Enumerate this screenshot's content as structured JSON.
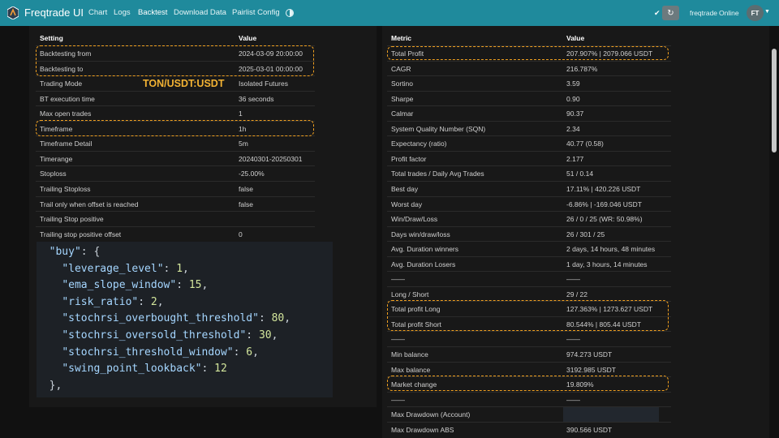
{
  "navbar": {
    "brand": "Freqtrade UI",
    "links": [
      "Chart",
      "Logs",
      "Backtest",
      "Download Data",
      "Pairlist Config"
    ],
    "active_link": "Backtest",
    "bot_name": "freqtrade",
    "bot_status": "Online",
    "avatar_initials": "FT",
    "icons": [
      "freqtrade-logo",
      "theme-toggle-icon",
      "check-icon",
      "refresh-icon",
      "caret-down-icon"
    ]
  },
  "left_table": {
    "header_setting": "Setting",
    "header_value": "Value",
    "rows": [
      {
        "label": "Backtesting from",
        "value": "2024-03-09 20:00:00"
      },
      {
        "label": "Backtesting to",
        "value": "2025-03-01 00:00:00"
      },
      {
        "label": "Trading Mode",
        "value": "Isolated Futures"
      },
      {
        "label": "BT execution time",
        "value": "36 seconds"
      },
      {
        "label": "Max open trades",
        "value": "1"
      },
      {
        "label": "Timeframe",
        "value": "1h"
      },
      {
        "label": "Timeframe Detail",
        "value": "5m"
      },
      {
        "label": "Timerange",
        "value": "20240301-20250301"
      },
      {
        "label": "Stoploss",
        "value": "-25.00%"
      },
      {
        "label": "Trailing Stoploss",
        "value": "false"
      },
      {
        "label": "Trail only when offset is reached",
        "value": "false"
      },
      {
        "label": "Trailing Stop positive",
        "value": ""
      },
      {
        "label": "Trailing stop positive offset",
        "value": "0"
      }
    ]
  },
  "overlay_label": "TON/USDT:USDT",
  "code": {
    "open_key": "buy",
    "params": [
      {
        "key": "leverage_level",
        "value": "1"
      },
      {
        "key": "ema_slope_window",
        "value": "15"
      },
      {
        "key": "risk_ratio",
        "value": "2"
      },
      {
        "key": "stochrsi_overbought_threshold",
        "value": "80"
      },
      {
        "key": "stochrsi_oversold_threshold",
        "value": "30"
      },
      {
        "key": "stochrsi_threshold_window",
        "value": "6"
      },
      {
        "key": "swing_point_lookback",
        "value": "12"
      }
    ],
    "close": "},"
  },
  "right_table": {
    "header_metric": "Metric",
    "header_value": "Value",
    "rows": [
      {
        "label": "Total Profit",
        "value": "207.907% | 2079.066 USDT"
      },
      {
        "label": "CAGR",
        "value": "216.787%"
      },
      {
        "label": "Sortino",
        "value": "3.59"
      },
      {
        "label": "Sharpe",
        "value": "0.90"
      },
      {
        "label": "Calmar",
        "value": "90.37"
      },
      {
        "label": "System Quality Number (SQN)",
        "value": "2.34"
      },
      {
        "label": "Expectancy (ratio)",
        "value": "40.77 (0.58)"
      },
      {
        "label": "Profit factor",
        "value": "2.177"
      },
      {
        "label": "Total trades / Daily Avg Trades",
        "value": "51 / 0.14"
      },
      {
        "label": "Best day",
        "value": "17.11% | 420.226 USDT"
      },
      {
        "label": "Worst day",
        "value": "-6.86% | -169.046 USDT"
      },
      {
        "label": "Win/Draw/Loss",
        "value": "26 / 0 / 25 (WR: 50.98%)"
      },
      {
        "label": "Days win/draw/loss",
        "value": "26 / 301 / 25"
      },
      {
        "label": "Avg. Duration winners",
        "value": "2 days, 14 hours, 48 minutes"
      },
      {
        "label": "Avg. Duration Losers",
        "value": "1 day, 3 hours, 14 minutes"
      },
      {
        "label": "——",
        "value": "——"
      },
      {
        "label": "Long / Short",
        "value": "29 / 22"
      },
      {
        "label": "Total profit Long",
        "value": "127.363% | 1273.627 USDT"
      },
      {
        "label": "Total profit Short",
        "value": "80.544% | 805.44 USDT"
      },
      {
        "label": "——",
        "value": "——"
      },
      {
        "label": "Min balance",
        "value": "974.273 USDT"
      },
      {
        "label": "Max balance",
        "value": "3192.985 USDT"
      },
      {
        "label": "Market change",
        "value": "19.809%"
      },
      {
        "label": "——",
        "value": "——"
      },
      {
        "label": "Max Drawdown (Account)",
        "value": ""
      },
      {
        "label": "Max Drawdown ABS",
        "value": "390.566 USDT"
      }
    ]
  },
  "colors": {
    "navbar": "#1f8a9c",
    "highlight": "#f0a020",
    "overlay_text": "#f2b233",
    "background": "#111111",
    "panel": "#181818"
  }
}
